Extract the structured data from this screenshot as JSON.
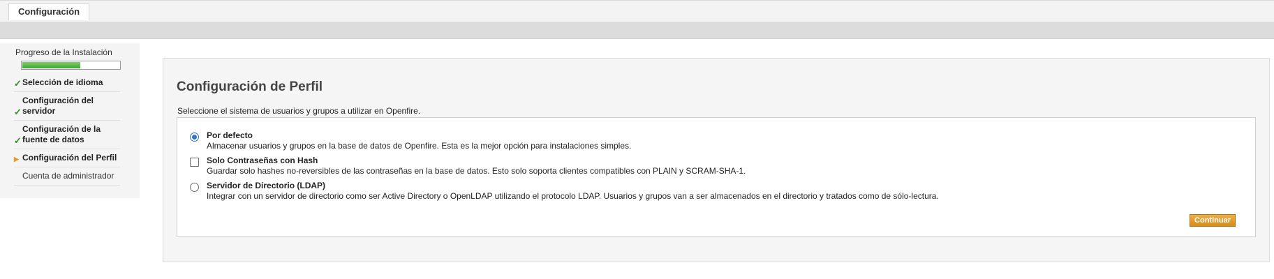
{
  "header": {
    "tab_label": "Configuración"
  },
  "sidebar": {
    "progress_label": "Progreso de la Instalación",
    "progress_fraction": 0.6,
    "steps": [
      {
        "label": "Selección de idioma",
        "status": "done"
      },
      {
        "label": "Configuración del servidor",
        "status": "done"
      },
      {
        "label": "Configuración de la fuente de datos",
        "status": "done"
      },
      {
        "label": "Configuración del Perfil",
        "status": "current"
      },
      {
        "label": "Cuenta de administrador",
        "status": "pending"
      }
    ]
  },
  "main": {
    "title": "Configuración de Perfil",
    "subtitle": "Seleccione el sistema de usuarios y grupos a utilizar en Openfire.",
    "options": [
      {
        "title": "Por defecto",
        "description": "Almacenar usuarios y grupos en la base de datos de Openfire. Esta es la mejor opción para instalaciones simples.",
        "control": "radio",
        "checked": true
      },
      {
        "title": "Solo Contraseñas con Hash",
        "description": "Guardar solo hashes no-reversibles de las contraseñas en la base de datos. Esto solo soporta clientes compatibles con PLAIN y SCRAM-SHA-1.",
        "control": "checkbox",
        "checked": false
      },
      {
        "title": "Servidor de Directorio (LDAP)",
        "description": "Integrar con un servidor de directorio como ser Active Directory o OpenLDAP utilizando el protocolo LDAP. Usuarios y grupos van a ser almacenados en el directorio y tratados como de sólo-lectura.",
        "control": "radio",
        "checked": false
      }
    ],
    "continue_label": "Continuar"
  },
  "colors": {
    "progress_fill": "#3ea534",
    "check": "#2f8f1f",
    "current_arrow": "#e39a1e",
    "continue_button": "#d98a16",
    "radio_selected": "#2b74c7"
  }
}
